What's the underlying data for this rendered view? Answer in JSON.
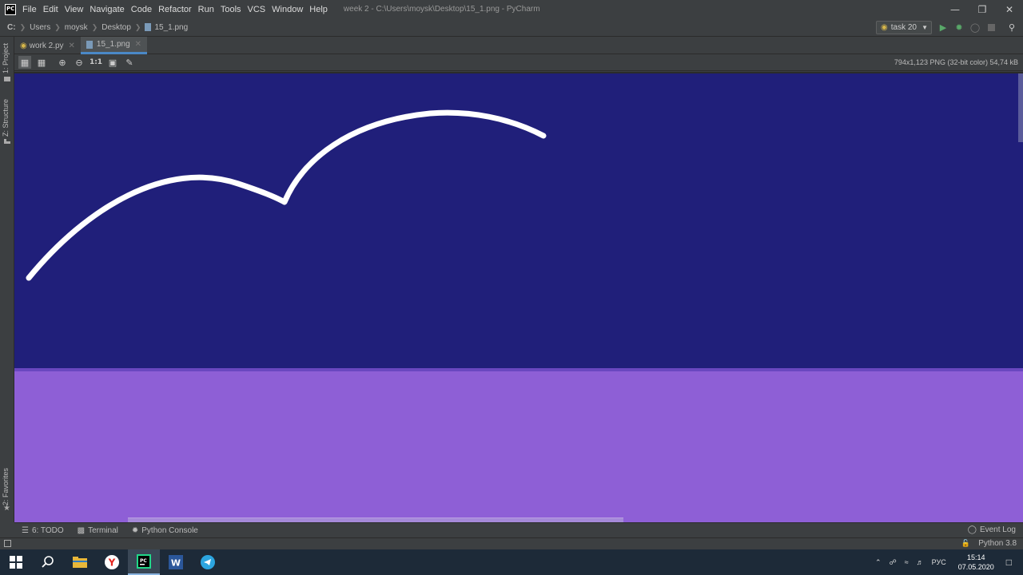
{
  "app": {
    "logo_text": "PC",
    "window_title": "week 2 - C:\\Users\\moysk\\Desktop\\15_1.png - PyCharm",
    "menu": [
      "File",
      "Edit",
      "View",
      "Navigate",
      "Code",
      "Refactor",
      "Run",
      "Tools",
      "VCS",
      "Window",
      "Help"
    ]
  },
  "navbar": {
    "breadcrumbs": [
      "C:",
      "Users",
      "moysk",
      "Desktop",
      "15_1.png"
    ],
    "run_config": "task 20"
  },
  "side_tabs": {
    "project": "1: Project",
    "structure": "Z: Structure",
    "favorites": "2: Favorites"
  },
  "tabs": [
    {
      "label": "work 2.py",
      "active": false
    },
    {
      "label": "15_1.png",
      "active": true
    }
  ],
  "image_toolbar": {
    "actual_size_label": "1:1",
    "info": "794x1,123 PNG (32-bit color) 54,74 kB"
  },
  "image": {
    "top_color": "#201f7a",
    "bottom_color": "#8e5fd6",
    "stroke_color": "#ffffff"
  },
  "bottom_tools": {
    "todo": "6: TODO",
    "terminal": "Terminal",
    "python_console": "Python Console",
    "event_log": "Event Log"
  },
  "status": {
    "interpreter": "Python 3.8"
  },
  "taskbar": {
    "language": "РУС",
    "time": "15:14",
    "date": "07.05.2020"
  },
  "colors": {
    "accent": "#4a88c7",
    "ide_bg": "#3c3f41"
  }
}
